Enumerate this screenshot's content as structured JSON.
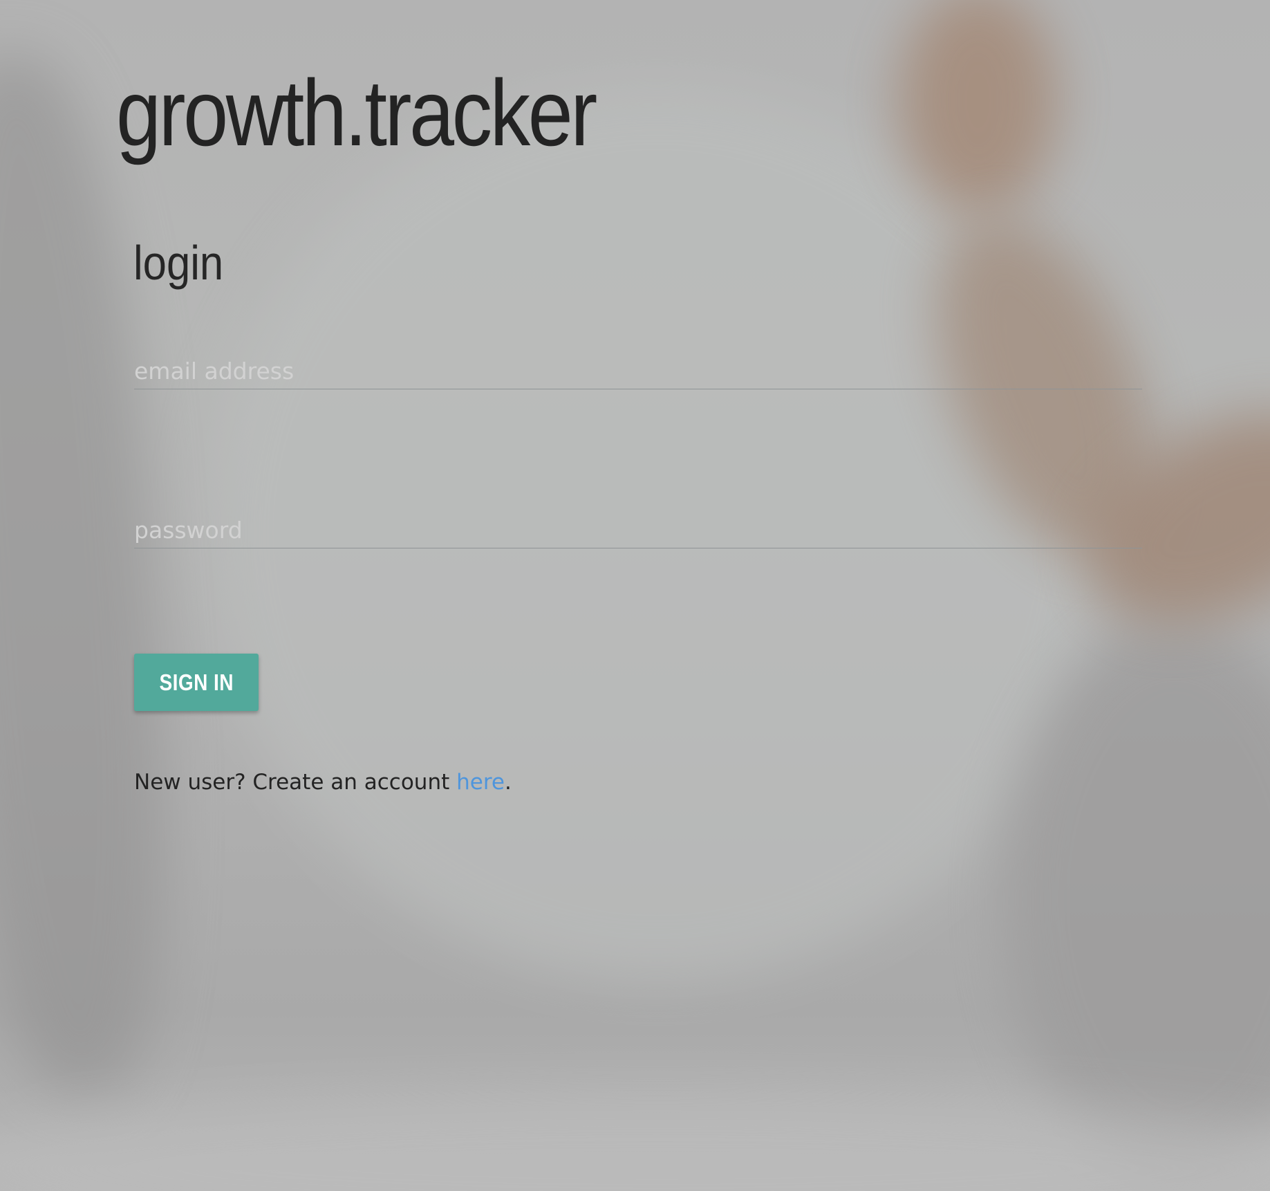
{
  "app": {
    "title": "growth.tracker"
  },
  "login": {
    "heading": "login",
    "email_placeholder": "email address",
    "email_value": "",
    "password_placeholder": "password",
    "password_value": "",
    "signin_label": "SIGN IN",
    "signup_prefix": "New user? Create an account ",
    "signup_link": "here",
    "signup_suffix": "."
  },
  "colors": {
    "accent": "#52a99b",
    "link": "#4e95dc",
    "text": "#232323",
    "placeholder": "#d2d2d2"
  }
}
